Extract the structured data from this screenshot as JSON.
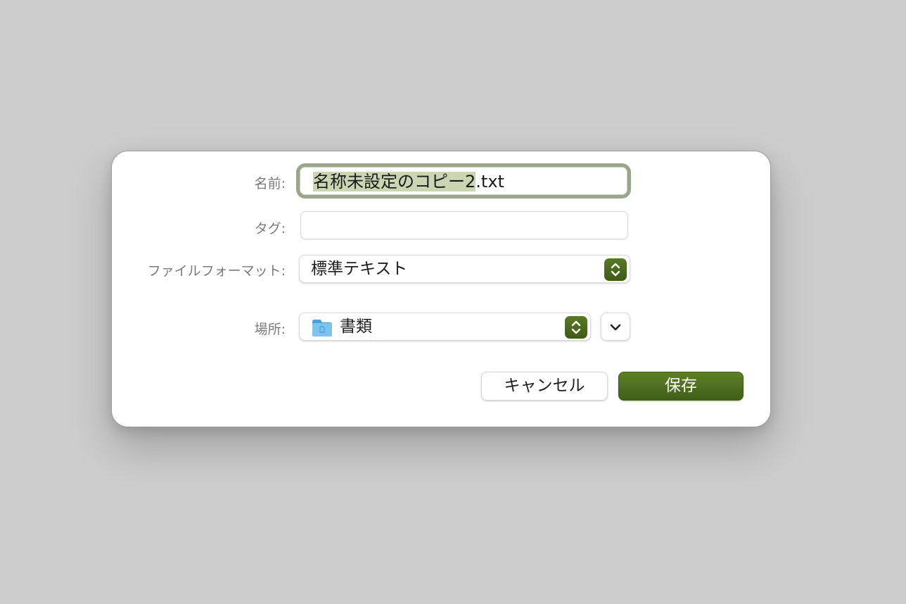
{
  "dialog": {
    "name": {
      "label": "名前:",
      "value_selected": "名称未設定のコピー2",
      "value_rest": ".txt"
    },
    "tags": {
      "label": "タグ:",
      "value": ""
    },
    "file_format": {
      "label": "ファイルフォーマット:",
      "selected": "標準テキスト"
    },
    "location": {
      "label": "場所:",
      "selected": "書類",
      "icon": "folder-icon"
    },
    "buttons": {
      "cancel": "キャンセル",
      "save": "保存"
    }
  },
  "colors": {
    "accent": "#4a6a1e",
    "focus_ring": "#9aa68a",
    "selection": "#cbd4b3",
    "background": "#cdcdcd",
    "folder": "#6cb6e6"
  }
}
